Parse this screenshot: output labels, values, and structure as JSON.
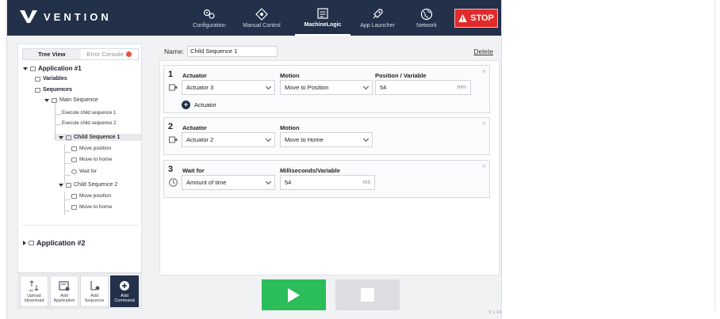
{
  "brand": "VENTION",
  "nav": [
    {
      "label": "Configuration",
      "icon": "gears-icon"
    },
    {
      "label": "Manual Control",
      "icon": "joystick-icon"
    },
    {
      "label": "MachineLogic",
      "icon": "code-window-icon",
      "active": true
    },
    {
      "label": "App Launcher",
      "icon": "rocket-icon"
    },
    {
      "label": "Network",
      "icon": "globe-icon"
    }
  ],
  "stop_label": "STOP",
  "tabs": {
    "tree": "Tree View",
    "console": "Error Console"
  },
  "tree": {
    "app1": "Application #1",
    "variables": "Variables",
    "sequences": "Sequences",
    "main_seq": "Main Sequence",
    "exec1": "Execute child sequence 1",
    "exec2": "Execute child sequence 2",
    "child1": "Child Sequence 1",
    "c1_move_pos": "Move position",
    "c1_move_home": "Move to home",
    "c1_wait": "Wait for",
    "child2": "Child Sequence 2",
    "c2_move_pos": "Move position",
    "c2_move_home": "Move to home",
    "app2": "Application #2"
  },
  "toolbar": [
    {
      "label": "Upload /download",
      "icon": "upload-download-icon"
    },
    {
      "label": "Add Application",
      "icon": "add-application-icon"
    },
    {
      "label": "Add Sequence",
      "icon": "add-sequence-icon"
    },
    {
      "label": "Add Command",
      "icon": "add-command-icon",
      "dark": true
    }
  ],
  "editor": {
    "name_label": "Name:",
    "name_value": "Child Sequence 1",
    "delete_label": "Delete",
    "steps": [
      {
        "num": "1",
        "h_actuator": "Actuator",
        "h_motion": "Motion",
        "h_position": "Position / Variable",
        "actuator": "Actuator 3",
        "motion": "Move to Position",
        "position": "54",
        "unit": "mm",
        "add_actuator": "Actuator"
      },
      {
        "num": "2",
        "h_actuator": "Actuator",
        "h_motion": "Motion",
        "actuator": "Actuator 2",
        "motion": "Move to Home"
      },
      {
        "num": "3",
        "h_wait": "Wait for",
        "h_ms": "Milliseconds/Variable",
        "wait": "Amount of time",
        "ms": "54",
        "unit": "ms"
      }
    ]
  },
  "version": "V 1.14"
}
